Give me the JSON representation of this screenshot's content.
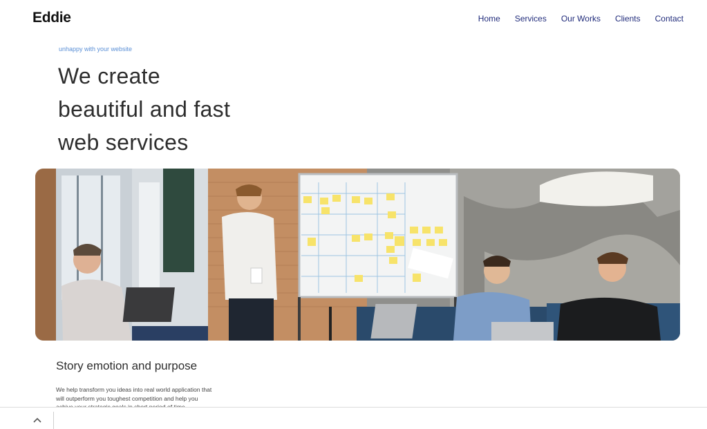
{
  "brand": {
    "logo_text": "Eddie"
  },
  "nav": {
    "items": [
      {
        "label": "Home"
      },
      {
        "label": "Services"
      },
      {
        "label": "Our Works"
      },
      {
        "label": "Clients"
      },
      {
        "label": "Contact"
      }
    ]
  },
  "hero": {
    "eyebrow": "unhappy with your website",
    "title_lines": [
      "We create",
      "beautiful and fast",
      "web services"
    ]
  },
  "story": {
    "title": "Story emotion and purpose",
    "body": "We help transform you ideas into real world application that will outperform you toughest competition and help you achive your strategic goals in short period of time."
  },
  "footer_bar": {
    "scroll_icon": "chevron-up-icon"
  },
  "colors": {
    "nav_link": "#1f2a7a",
    "eyebrow": "#5a8fd6",
    "heading": "#2d2d2d"
  }
}
